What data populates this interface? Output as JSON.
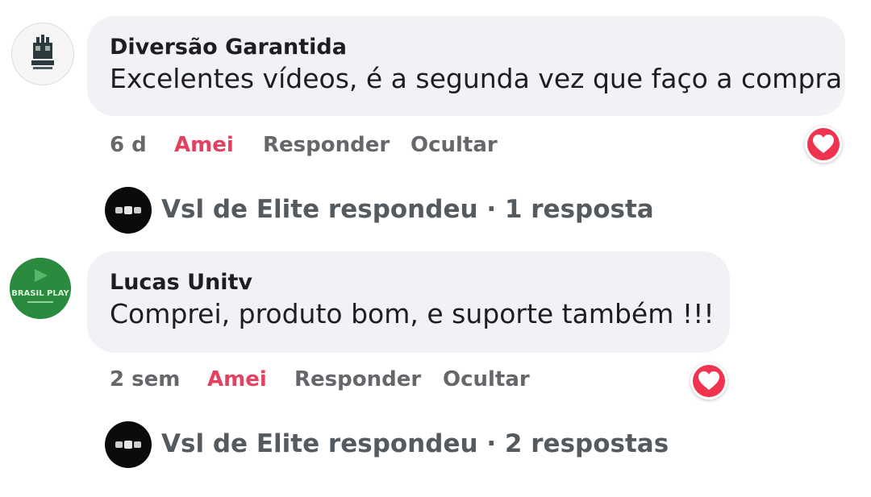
{
  "comments": [
    {
      "author": "Diversão Garantida",
      "text": "Excelentes vídeos, é a segunda vez que faço a compra",
      "time": "6 d",
      "love_label": "Amei",
      "reply_label": "Responder",
      "hide_label": "Ocultar",
      "reaction": "heart-icon",
      "replies_text": "Vsl de Elite respondeu · 1 resposta"
    },
    {
      "author": "Lucas Unitv",
      "text": "Comprei, produto bom, e suporte também !!!",
      "time": "2 sem",
      "love_label": "Amei",
      "reply_label": "Responder",
      "hide_label": "Ocultar",
      "reaction": "heart-icon",
      "avatar_logo_text": "BRASIL PLAY",
      "replies_text": "Vsl de Elite respondeu · 2 respostas"
    }
  ],
  "colors": {
    "bubble": "#f0f2f5",
    "love": "#e4405f",
    "reaction": "#f0334f",
    "action_text": "#65676b",
    "avatar_green": "#2a8a3e"
  }
}
